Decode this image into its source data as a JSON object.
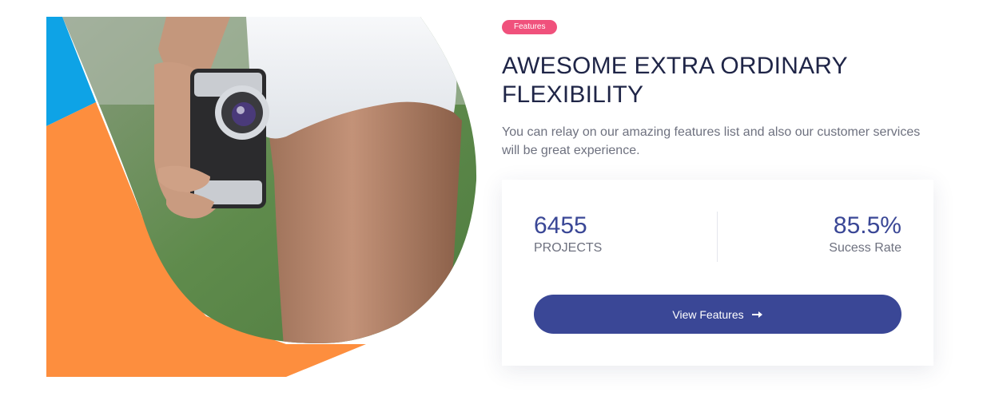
{
  "badge": {
    "label": "Features",
    "color": "#f0517c"
  },
  "headline": "AWESOME EXTRA ORDINARY FLEXIBILITY",
  "subtext": "You can relay on our amazing features list and also our customer services will be great experience.",
  "stats": [
    {
      "value": "6455",
      "label": "PROJECTS"
    },
    {
      "value": "85.5%",
      "label": "Sucess Rate"
    }
  ],
  "cta": {
    "label": "View Features",
    "icon": "arrow-right-icon"
  },
  "colors": {
    "accent": "#3a4796",
    "heading": "#1f2547",
    "body_text": "#6e717f",
    "shape_blue": "#0ea3e6",
    "shape_orange": "#fd8e3e"
  },
  "hero_image": {
    "subject": "photo-of-person-holding-vintage-camera"
  }
}
